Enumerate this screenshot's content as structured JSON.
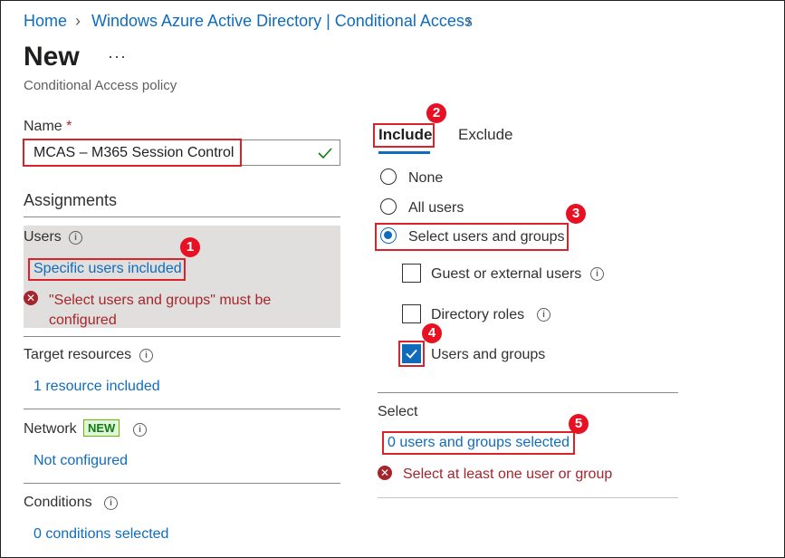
{
  "breadcrumb": {
    "home": "Home",
    "page": "Windows Azure Active Directory | Conditional Access"
  },
  "header": {
    "title": "New",
    "more": "···",
    "subtitle": "Conditional Access policy"
  },
  "left": {
    "name_label": "Name",
    "required_mark": "*",
    "name_value": "MCAS – M365 Session Control",
    "assignments_heading": "Assignments",
    "users_label": "Users",
    "users_link": "Specific users included",
    "users_error": "\"Select users and groups\" must be configured",
    "target_label": "Target resources",
    "target_link": "1 resource included",
    "network_label": "Network",
    "network_badge": "NEW",
    "network_link": "Not configured",
    "conditions_label": "Conditions",
    "conditions_link": "0 conditions selected"
  },
  "right": {
    "tabs": [
      "Include",
      "Exclude"
    ],
    "radios": [
      "None",
      "All users",
      "Select users and groups"
    ],
    "checkboxes": [
      "Guest or external users",
      "Directory roles",
      "Users and groups"
    ],
    "select_label": "Select",
    "select_link": "0 users and groups selected",
    "select_error": "Select at least one user or group"
  },
  "annotations": [
    "1",
    "2",
    "3",
    "4",
    "5"
  ],
  "colors": {
    "link": "#0f6cbd",
    "error": "#a4262c",
    "annotation": "#e81123",
    "selected_panel": "#e1dfdd"
  }
}
